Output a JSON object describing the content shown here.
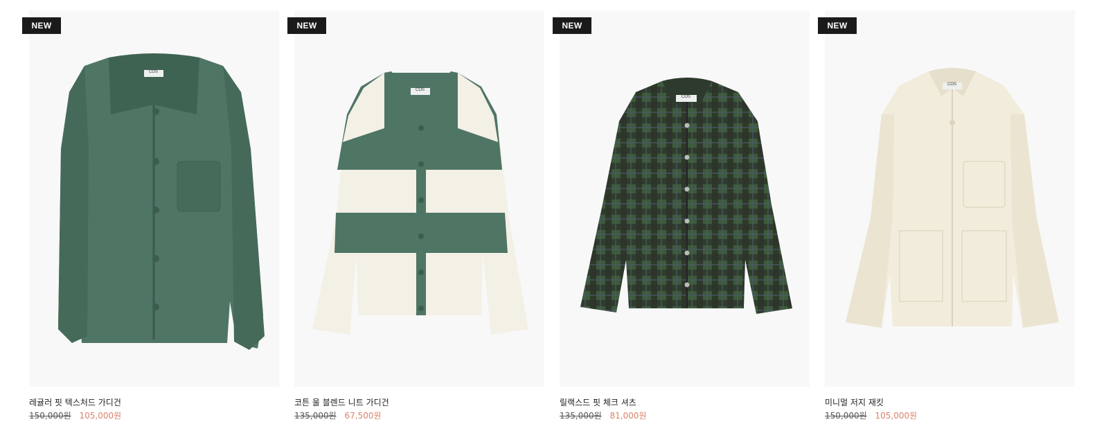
{
  "colors": {
    "badge_bg": "#1a1a1a",
    "sale_price": "#d9826a",
    "image_bg": "#f8f8f8"
  },
  "products": [
    {
      "badge": "NEW",
      "name": "레귤러 핏 텍스처드 가디건",
      "original_price": "150,000원",
      "sale_price": "105,000원",
      "image": "green-textured-cardigan",
      "label": "COS"
    },
    {
      "badge": "NEW",
      "name": "코튼 울 블렌드 니트 가디건",
      "original_price": "135,000원",
      "sale_price": "67,500원",
      "image": "green-cream-striped-cardigan",
      "label": "COS"
    },
    {
      "badge": "NEW",
      "name": "릴랙스드 핏 체크 셔츠",
      "original_price": "135,000원",
      "sale_price": "81,000원",
      "image": "green-check-shirt",
      "label": "COS"
    },
    {
      "badge": "NEW",
      "name": "미니멀 저지 재킷",
      "original_price": "150,000원",
      "sale_price": "105,000원",
      "image": "cream-jersey-jacket",
      "label": "COS"
    }
  ]
}
